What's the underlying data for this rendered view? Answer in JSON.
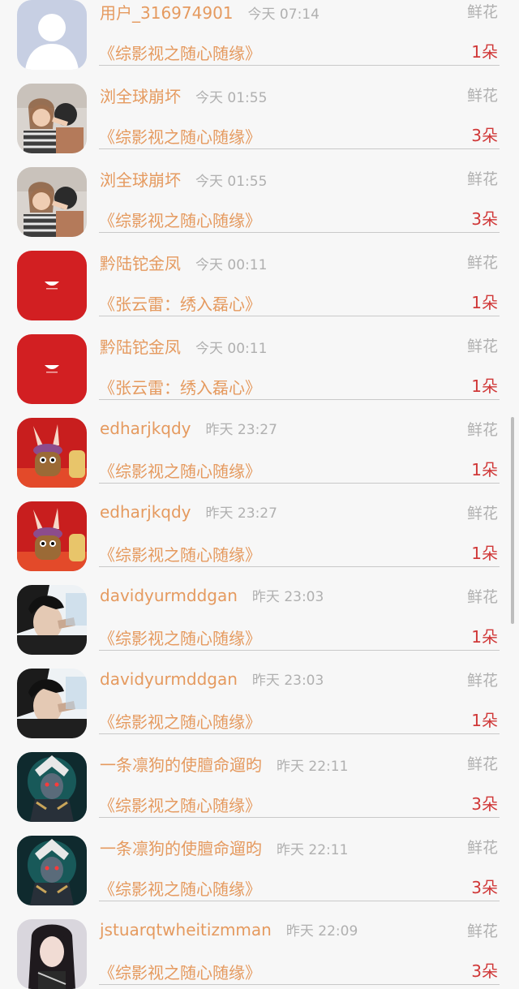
{
  "gift_label": "鲜花",
  "rows": [
    {
      "name": "用户_316974901",
      "time": "今天 07:14",
      "book": "《综影视之随心随缘》",
      "count": "1朵",
      "avatar": "default-avatar-icon"
    },
    {
      "name": "浏全球崩坏",
      "time": "今天 01:55",
      "book": "《综影视之随心随缘》",
      "count": "3朵",
      "avatar": "photo-avatar-girls"
    },
    {
      "name": "浏全球崩坏",
      "time": "今天 01:55",
      "book": "《综影视之随心随缘》",
      "count": "3朵",
      "avatar": "photo-avatar-girls"
    },
    {
      "name": "黔陆铊金凤",
      "time": "今天 00:11",
      "book": "《张云雷：绣入磊心》",
      "count": "1朵",
      "avatar": "red-logo-avatar"
    },
    {
      "name": "黔陆铊金凤",
      "time": "今天 00:11",
      "book": "《张云雷：绣入磊心》",
      "count": "1朵",
      "avatar": "red-logo-avatar"
    },
    {
      "name": "edharjkqdy",
      "time": "昨天 23:27",
      "book": "《综影视之随心随缘》",
      "count": "1朵",
      "avatar": "cartoon-avatar"
    },
    {
      "name": "edharjkqdy",
      "time": "昨天 23:27",
      "book": "《综影视之随心随缘》",
      "count": "1朵",
      "avatar": "cartoon-avatar"
    },
    {
      "name": "davidyurmddgan",
      "time": "昨天 23:03",
      "book": "《综影视之随心随缘》",
      "count": "1朵",
      "avatar": "photo-avatar-man"
    },
    {
      "name": "davidyurmddgan",
      "time": "昨天 23:03",
      "book": "《综影视之随心随缘》",
      "count": "1朵",
      "avatar": "photo-avatar-man"
    },
    {
      "name": "一条凛狗的使膻命遛昀",
      "time": "昨天 22:11",
      "book": "《综影视之随心随缘》",
      "count": "3朵",
      "avatar": "game-character-avatar"
    },
    {
      "name": "一条凛狗的使膻命遛昀",
      "time": "昨天 22:11",
      "book": "《综影视之随心随缘》",
      "count": "3朵",
      "avatar": "game-character-avatar"
    },
    {
      "name": "jstuarqtwheitizmman",
      "time": "昨天 22:09",
      "book": "《综影视之随心随缘》",
      "count": "3朵",
      "avatar": "photo-avatar-woman"
    }
  ],
  "colors": {
    "name": "#e59a5f",
    "book": "#e59a5f",
    "time": "#b0b0b0",
    "count": "#d03838",
    "background": "#f7f7f7"
  }
}
